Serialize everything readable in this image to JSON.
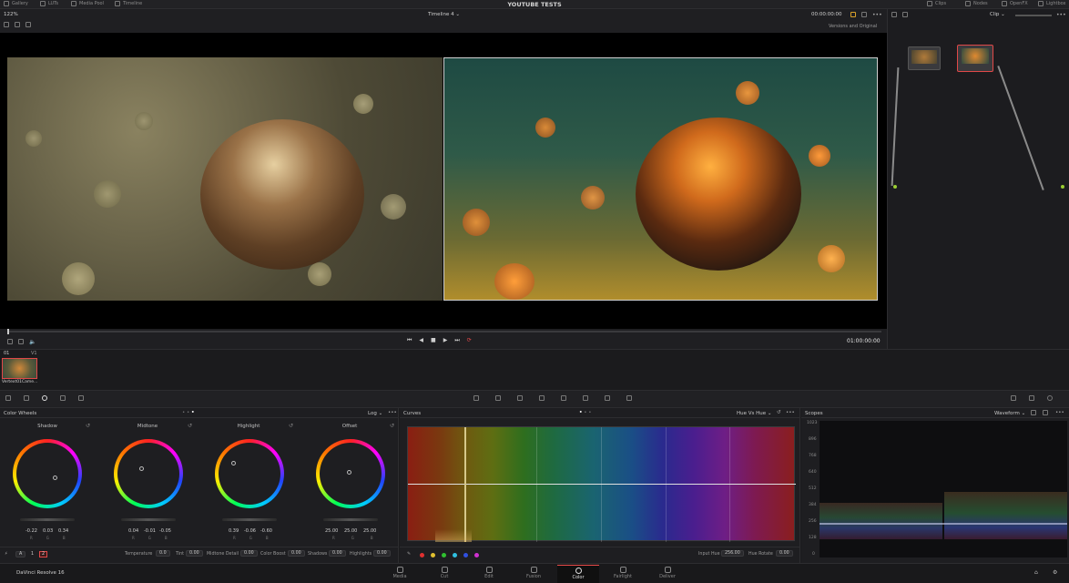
{
  "topbar": {
    "left_tabs": [
      "Gallery",
      "LUTs",
      "Media Pool",
      "Timeline"
    ],
    "title": "YOUTUBE TESTS",
    "right_tabs": [
      "Clips",
      "Nodes",
      "OpenFX",
      "Lightbox"
    ]
  },
  "viewer": {
    "zoom": "122%",
    "timeline_name": "Timeline 4",
    "timecode_top": "00:00:00:00",
    "compare_mode": "Versions and Original",
    "timecode_bottom": "01:00:00:00"
  },
  "nodes": {
    "mode": "Clip"
  },
  "thumbs": {
    "index": "01",
    "track": "V1",
    "clip_name": "Vertext01Came..."
  },
  "color_wheels": {
    "title": "Color Wheels",
    "mode": "Log",
    "wheels": [
      {
        "label": "Shadow",
        "values": [
          "-0.22",
          "0.03",
          "0.34"
        ]
      },
      {
        "label": "Midtone",
        "values": [
          "0.04",
          "-0.01",
          "-0.05"
        ]
      },
      {
        "label": "Highlight",
        "values": [
          "0.39",
          "-0.06",
          "-0.60"
        ]
      },
      {
        "label": "Offset",
        "values": [
          "25.00",
          "25.00",
          "25.00"
        ]
      }
    ],
    "rgb": [
      "R",
      "G",
      "B"
    ],
    "page_numbers": [
      "1",
      "2"
    ],
    "params": [
      {
        "label": "Temperature",
        "value": "0.0"
      },
      {
        "label": "Tint",
        "value": "0.00"
      },
      {
        "label": "Midtone Detail",
        "value": "0.00"
      },
      {
        "label": "Color Boost",
        "value": "0.00"
      },
      {
        "label": "Shadows",
        "value": "0.00"
      },
      {
        "label": "Highlights",
        "value": "0.00"
      }
    ]
  },
  "curves": {
    "title": "Curves",
    "mode": "Hue Vs Hue",
    "input_hue_label": "Input Hue",
    "input_hue_value": "256.00",
    "hue_rotate_label": "Hue Rotate",
    "hue_rotate_value": "0.00",
    "swatch_colors": [
      "#e03030",
      "#e0c030",
      "#30c030",
      "#30c0e0",
      "#3050e0",
      "#d030d0"
    ]
  },
  "scopes": {
    "title": "Scopes",
    "mode": "Waveform",
    "ticks": [
      "1023",
      "896",
      "768",
      "640",
      "512",
      "384",
      "256",
      "128",
      "0"
    ]
  },
  "bottombar": {
    "app_name": "DaVinci Resolve 16",
    "tabs": [
      "Media",
      "Cut",
      "Edit",
      "Fusion",
      "Color",
      "Fairlight",
      "Deliver"
    ],
    "active_tab": "Color"
  }
}
